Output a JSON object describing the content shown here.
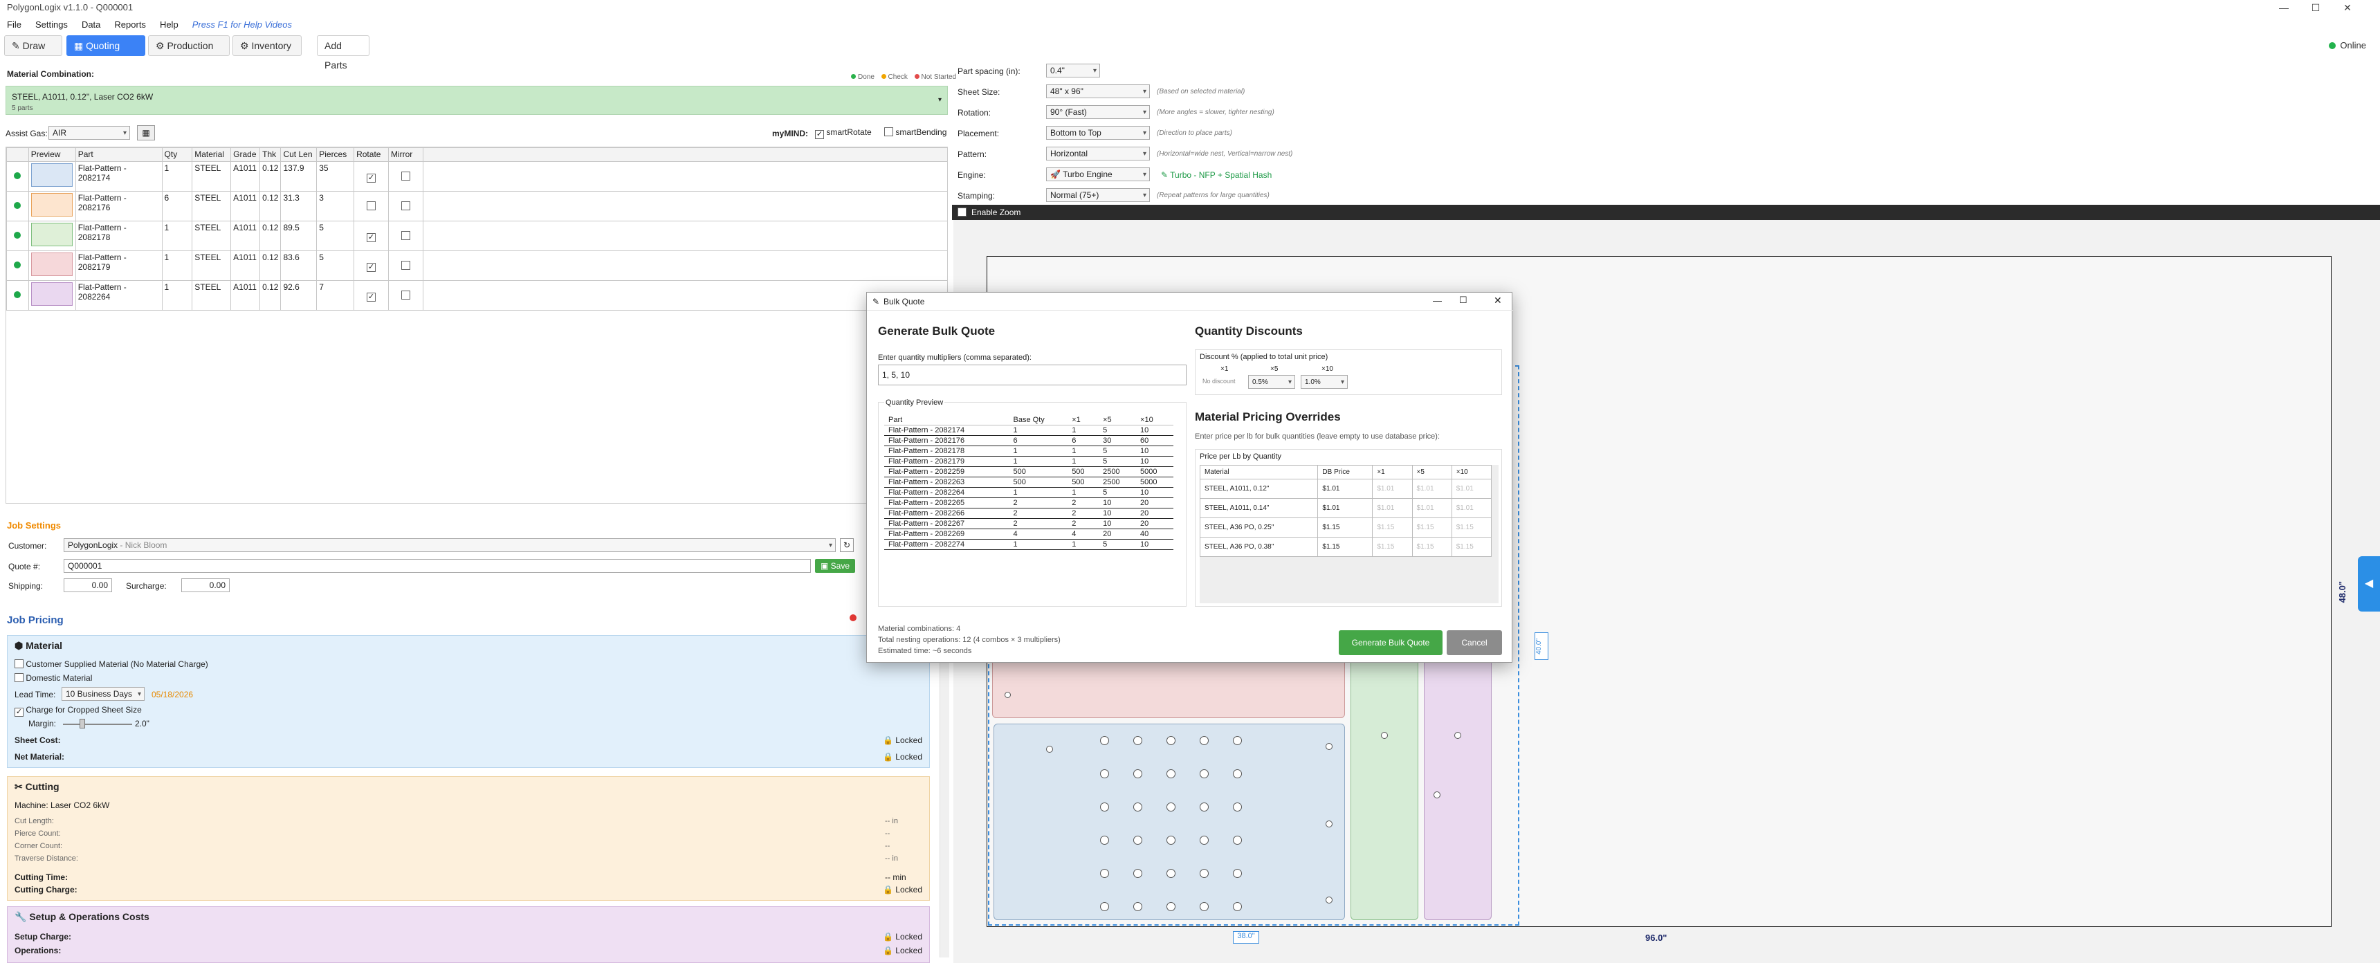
{
  "app": {
    "title": "PolygonLogix v1.1.0 - Q000001"
  },
  "menu": {
    "items": [
      "File",
      "Settings",
      "Data",
      "Reports",
      "Help"
    ],
    "hint": "Press F1 for Help Videos"
  },
  "toolbar": {
    "draw": "Draw",
    "quoting": "Quoting",
    "production": "Production",
    "inventory": "Inventory",
    "add_parts": "Add Parts",
    "status": "Online"
  },
  "material": {
    "label": "Material Combination:",
    "legend": [
      "Done",
      "Check",
      "Not Started"
    ],
    "combo": "STEEL, A1011, 0.12\", Laser CO2 6kW",
    "parts_count": "5 parts"
  },
  "assist": {
    "label": "Assist Gas:",
    "value": "AIR",
    "mymind": "myMIND:",
    "smart_rotate": "smartRotate",
    "smart_bending": "smartBending"
  },
  "parts": {
    "columns": [
      "Preview",
      "Part",
      "Qty",
      "Material",
      "Grade",
      "Thk",
      "Cut Len",
      "Pierces",
      "Rotate",
      "Mirror"
    ],
    "rows": [
      {
        "part": "Flat-Pattern - 2082174",
        "qty": "1",
        "material": "STEEL",
        "grade": "A1011",
        "thk": "0.12",
        "cut": "137.9",
        "pierces": "35",
        "rotate": "✓",
        "mirror": ""
      },
      {
        "part": "Flat-Pattern - 2082176",
        "qty": "6",
        "material": "STEEL",
        "grade": "A1011",
        "thk": "0.12",
        "cut": "31.3",
        "pierces": "3",
        "rotate": "",
        "mirror": ""
      },
      {
        "part": "Flat-Pattern - 2082178",
        "qty": "1",
        "material": "STEEL",
        "grade": "A1011",
        "thk": "0.12",
        "cut": "89.5",
        "pierces": "5",
        "rotate": "✓",
        "mirror": ""
      },
      {
        "part": "Flat-Pattern - 2082179",
        "qty": "1",
        "material": "STEEL",
        "grade": "A1011",
        "thk": "0.12",
        "cut": "83.6",
        "pierces": "5",
        "rotate": "✓",
        "mirror": ""
      },
      {
        "part": "Flat-Pattern - 2082264",
        "qty": "1",
        "material": "STEEL",
        "grade": "A1011",
        "thk": "0.12",
        "cut": "92.6",
        "pierces": "7",
        "rotate": "✓",
        "mirror": ""
      }
    ]
  },
  "nest": {
    "part_spacing": {
      "label": "Part spacing (in):",
      "value": "0.4\""
    },
    "sheet_size": {
      "label": "Sheet Size:",
      "value": "48\" x 96\"",
      "hint": "(Based on selected material)"
    },
    "rotation": {
      "label": "Rotation:",
      "value": "90° (Fast)",
      "hint": "(More angles = slower, tighter nesting)"
    },
    "placement": {
      "label": "Placement:",
      "value": "Bottom to Top",
      "hint": "(Direction to place parts)"
    },
    "pattern": {
      "label": "Pattern:",
      "value": "Horizontal",
      "hint": "(Horizontal=wide nest, Vertical=narrow nest)"
    },
    "engine": {
      "label": "Engine:",
      "value": "Turbo Engine",
      "badge": "Turbo - NFP + Spatial Hash"
    },
    "stamping": {
      "label": "Stamping:",
      "value": "Normal (75+)",
      "hint": "(Repeat patterns for large quantities)"
    },
    "enable_zoom": "Enable Zoom",
    "dims": {
      "width": "96.0\"",
      "height": "48.0\"",
      "part_w": "38.0\"",
      "part_h": "40.0\""
    }
  },
  "job_settings": {
    "title": "Job Settings",
    "customer_label": "Customer:",
    "customer": "PolygonLogix",
    "contact": "- Nick Bloom",
    "quote_label": "Quote #:",
    "quote": "Q000001",
    "save": "Save",
    "shipping_label": "Shipping:",
    "shipping": "0.00",
    "surcharge_label": "Surcharge:",
    "surcharge": "0.00"
  },
  "job_pricing": {
    "title": "Job Pricing",
    "material": {
      "title": "Material",
      "customer_supplied": "Customer Supplied Material (No Material Charge)",
      "domestic": "Domestic Material",
      "lead_label": "Lead Time:",
      "lead": "10 Business Days",
      "lead_date": "05/18/2026",
      "crop": "Charge for Cropped Sheet Size",
      "margin_label": "Margin:",
      "margin": "2.0\"",
      "sheet_cost": "Sheet Cost:",
      "net_material": "Net Material:",
      "locked": "Locked"
    },
    "cutting": {
      "title": "Cutting",
      "machine": "Machine:  Laser CO2 6kW",
      "cut_length": "Cut Length:",
      "pierce_count": "Pierce Count:",
      "corner_count": "Corner Count:",
      "traverse": "Traverse Distance:",
      "cutting_time": "Cutting Time:",
      "cutting_charge": "Cutting Charge:",
      "in": "-- in",
      "dash": "--",
      "min": "-- min"
    },
    "setup": {
      "title": "Setup & Operations Costs",
      "setup_charge": "Setup Charge:",
      "operations": "Operations:"
    }
  },
  "dialog": {
    "title": "Bulk Quote",
    "generate_title": "Generate Bulk Quote",
    "mult_label": "Enter quantity multipliers (comma separated):",
    "mult_value": "1, 5, 10",
    "preview_title": "Quantity Preview",
    "preview_cols": [
      "Part",
      "Base Qty",
      "×1",
      "×5",
      "×10"
    ],
    "preview_rows": [
      [
        "Flat-Pattern - 2082174",
        "1",
        "1",
        "5",
        "10"
      ],
      [
        "Flat-Pattern - 2082176",
        "6",
        "6",
        "30",
        "60"
      ],
      [
        "Flat-Pattern - 2082178",
        "1",
        "1",
        "5",
        "10"
      ],
      [
        "Flat-Pattern - 2082179",
        "1",
        "1",
        "5",
        "10"
      ],
      [
        "Flat-Pattern - 2082259",
        "500",
        "500",
        "2500",
        "5000"
      ],
      [
        "Flat-Pattern - 2082263",
        "500",
        "500",
        "2500",
        "5000"
      ],
      [
        "Flat-Pattern - 2082264",
        "1",
        "1",
        "5",
        "10"
      ],
      [
        "Flat-Pattern - 2082265",
        "2",
        "2",
        "10",
        "20"
      ],
      [
        "Flat-Pattern - 2082266",
        "2",
        "2",
        "10",
        "20"
      ],
      [
        "Flat-Pattern - 2082267",
        "2",
        "2",
        "10",
        "20"
      ],
      [
        "Flat-Pattern - 2082269",
        "4",
        "4",
        "20",
        "40"
      ],
      [
        "Flat-Pattern - 2082274",
        "1",
        "1",
        "5",
        "10"
      ]
    ],
    "combos": "Material combinations: 4",
    "nest_ops": "Total nesting operations: 12 (4 combos × 3 multipliers)",
    "est_time": "Estimated time: ~6 seconds",
    "discounts_title": "Quantity Discounts",
    "discount_label": "Discount % (applied to total unit price)",
    "discount_cols": [
      "×1",
      "×5",
      "×10"
    ],
    "no_discount": "No discount",
    "discount_5": "0.5%",
    "discount_10": "1.0%",
    "overrides_title": "Material Pricing Overrides",
    "overrides_hint": "Enter price per lb for bulk quantities (leave empty to use database price):",
    "ppl_title": "Price per Lb by Quantity",
    "ppl_cols": [
      "Material",
      "DB Price",
      "×1",
      "×5",
      "×10"
    ],
    "ppl_rows": [
      [
        "STEEL, A1011, 0.12\"",
        "$1.01",
        "$1.01",
        "$1.01",
        "$1.01"
      ],
      [
        "STEEL, A1011, 0.14\"",
        "$1.01",
        "$1.01",
        "$1.01",
        "$1.01"
      ],
      [
        "STEEL, A36 PO, 0.25\"",
        "$1.15",
        "$1.15",
        "$1.15",
        "$1.15"
      ],
      [
        "STEEL, A36 PO, 0.38\"",
        "$1.15",
        "$1.15",
        "$1.15",
        "$1.15"
      ]
    ],
    "generate": "Generate Bulk Quote",
    "cancel": "Cancel"
  }
}
